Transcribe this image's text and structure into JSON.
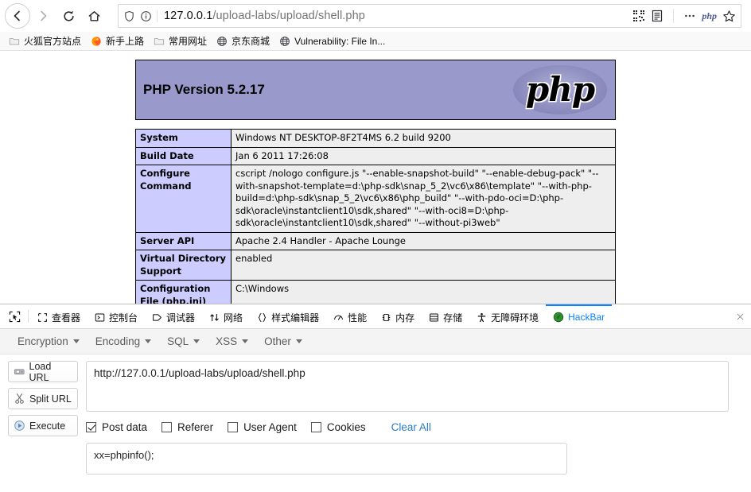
{
  "browser": {
    "nav": {
      "back_icon": "arrow-left-icon",
      "forward_icon": "arrow-right-icon",
      "reload_icon": "reload-icon",
      "home_icon": "home-icon"
    },
    "urlbar": {
      "shield_icon": "shield-icon",
      "info_icon": "info-circle-icon",
      "url_host": "127.0.0.1",
      "url_path": "/upload-labs/upload/shell.php",
      "full_url": "127.0.0.1/upload-labs/upload/shell.php",
      "qr_icon": "qr-code-icon",
      "reader_icon": "reader-view-icon",
      "more_icon": "ellipsis-icon",
      "php_icon": "php-extension-icon",
      "php_label": "php",
      "bookmark_icon": "star-icon"
    },
    "bookmarks": [
      {
        "label": "火狐官方站点",
        "icon": "folder-icon"
      },
      {
        "label": "新手上路",
        "icon": "firefox-icon"
      },
      {
        "label": "常用网址",
        "icon": "folder-icon"
      },
      {
        "label": "京东商城",
        "icon": "globe-icon"
      },
      {
        "label": "Vulnerability: File In...",
        "icon": "globe-icon"
      }
    ]
  },
  "phpinfo": {
    "version_title": "PHP Version 5.2.17",
    "logo_text": "php",
    "header_bg": "#9999cc",
    "rows": [
      {
        "key": "System",
        "value": "Windows NT DESKTOP-8F2T4MS 6.2 build 9200"
      },
      {
        "key": "Build Date",
        "value": "Jan 6 2011 17:26:08"
      },
      {
        "key": "Configure Command",
        "value": "cscript /nologo configure.js \"--enable-snapshot-build\" \"--enable-debug-pack\" \"--with-snapshot-template=d:\\php-sdk\\snap_5_2\\vc6\\x86\\template\" \"--with-php-build=d:\\php-sdk\\snap_5_2\\vc6\\x86\\php_build\" \"--with-pdo-oci=D:\\php-sdk\\oracle\\instantclient10\\sdk,shared\" \"--with-oci8=D:\\php-sdk\\oracle\\instantclient10\\sdk,shared\" \"--without-pi3web\""
      },
      {
        "key": "Server API",
        "value": "Apache 2.4 Handler - Apache Lounge"
      },
      {
        "key": "Virtual Directory Support",
        "value": "enabled"
      },
      {
        "key": "Configuration File (php.ini) Path",
        "value": "C:\\Windows"
      }
    ]
  },
  "devtools": {
    "picker_icon": "element-picker-icon",
    "tabs": [
      {
        "label": "查看器",
        "icon": "inspector-icon",
        "active": false
      },
      {
        "label": "控制台",
        "icon": "console-icon",
        "active": false
      },
      {
        "label": "调试器",
        "icon": "debugger-icon",
        "active": false
      },
      {
        "label": "网络",
        "icon": "network-icon",
        "active": false
      },
      {
        "label": "样式编辑器",
        "icon": "style-editor-icon",
        "active": false
      },
      {
        "label": "性能",
        "icon": "performance-icon",
        "active": false
      },
      {
        "label": "内存",
        "icon": "memory-icon",
        "active": false
      },
      {
        "label": "存储",
        "icon": "storage-icon",
        "active": false
      },
      {
        "label": "无障碍环境",
        "icon": "accessibility-icon",
        "active": false
      },
      {
        "label": "HackBar",
        "icon": "hackbar-icon",
        "active": true
      }
    ],
    "active_tab_color": "#0a84ff"
  },
  "hackbar": {
    "menus": [
      {
        "label": "Encryption"
      },
      {
        "label": "Encoding"
      },
      {
        "label": "SQL"
      },
      {
        "label": "XSS"
      },
      {
        "label": "Other"
      }
    ],
    "buttons": [
      {
        "label": "Load URL",
        "icon": "load-url-icon"
      },
      {
        "label": "Split URL",
        "icon": "split-url-icon"
      },
      {
        "label": "Execute",
        "icon": "execute-icon"
      }
    ],
    "url_value": "http://127.0.0.1/upload-labs/upload/shell.php",
    "url_placeholder": "",
    "checkboxes": [
      {
        "label": "Post data",
        "checked": true
      },
      {
        "label": "Referer",
        "checked": false
      },
      {
        "label": "User Agent",
        "checked": false
      },
      {
        "label": "Cookies",
        "checked": false
      }
    ],
    "clear_all_label": "Clear All",
    "clear_all_color": "#2b7bc8",
    "postdata_value": "xx=phpinfo();"
  }
}
